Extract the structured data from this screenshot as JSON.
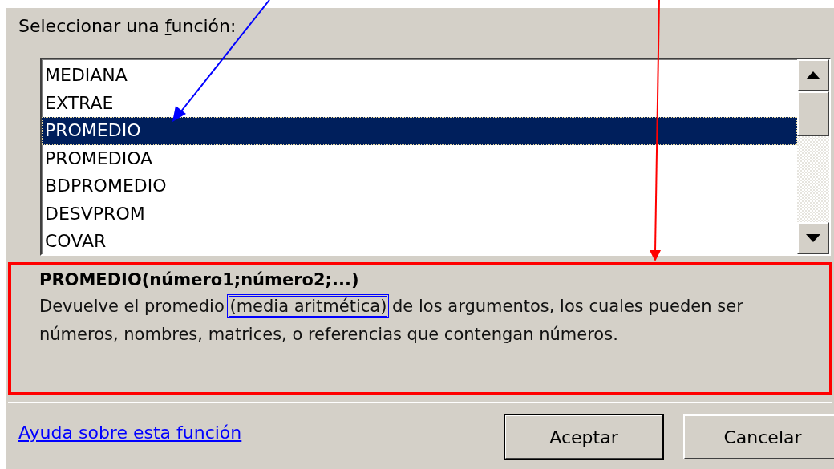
{
  "label": {
    "before": "Seleccionar una ",
    "access_key": "f",
    "after": "unción:"
  },
  "functions": [
    {
      "name": "MEDIANA",
      "selected": false
    },
    {
      "name": "EXTRAE",
      "selected": false
    },
    {
      "name": "PROMEDIO",
      "selected": true
    },
    {
      "name": "PROMEDIOA",
      "selected": false
    },
    {
      "name": "BDPROMEDIO",
      "selected": false
    },
    {
      "name": "DESVPROM",
      "selected": false
    },
    {
      "name": "COVAR",
      "selected": false
    }
  ],
  "syntax": "PROMEDIO(número1;número2;...)",
  "description": {
    "before": "Devuelve el promedio",
    "highlighted": "(media aritmética)",
    "after": "de los argumentos, los cuales pueden ser números, nombres, matrices, o referencias que contengan números."
  },
  "help_link": "Ayuda sobre esta función",
  "buttons": [
    {
      "label": "Aceptar",
      "default": true
    },
    {
      "label": "Cancelar",
      "default": false
    }
  ]
}
